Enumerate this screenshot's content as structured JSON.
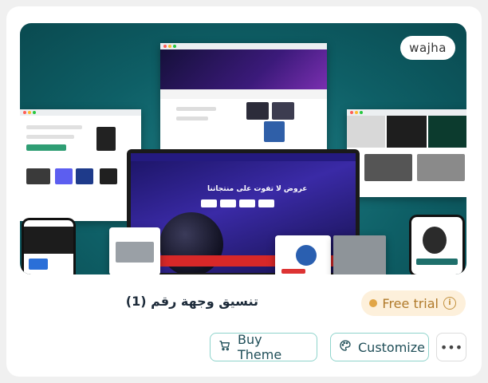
{
  "card": {
    "brand": "wajha",
    "title": "تنسيق وجهة رقم (1)",
    "badge": {
      "label": "Free trial",
      "info_icon": "info-icon",
      "color": "#e1a546"
    },
    "buttons": {
      "buy_label": "Buy Theme",
      "customize_label": "Customize",
      "more_label": "•••"
    },
    "preview": {
      "hero_text": "عروض لا تفوت على منتجاتنا",
      "accent": "#0e5f66"
    }
  }
}
